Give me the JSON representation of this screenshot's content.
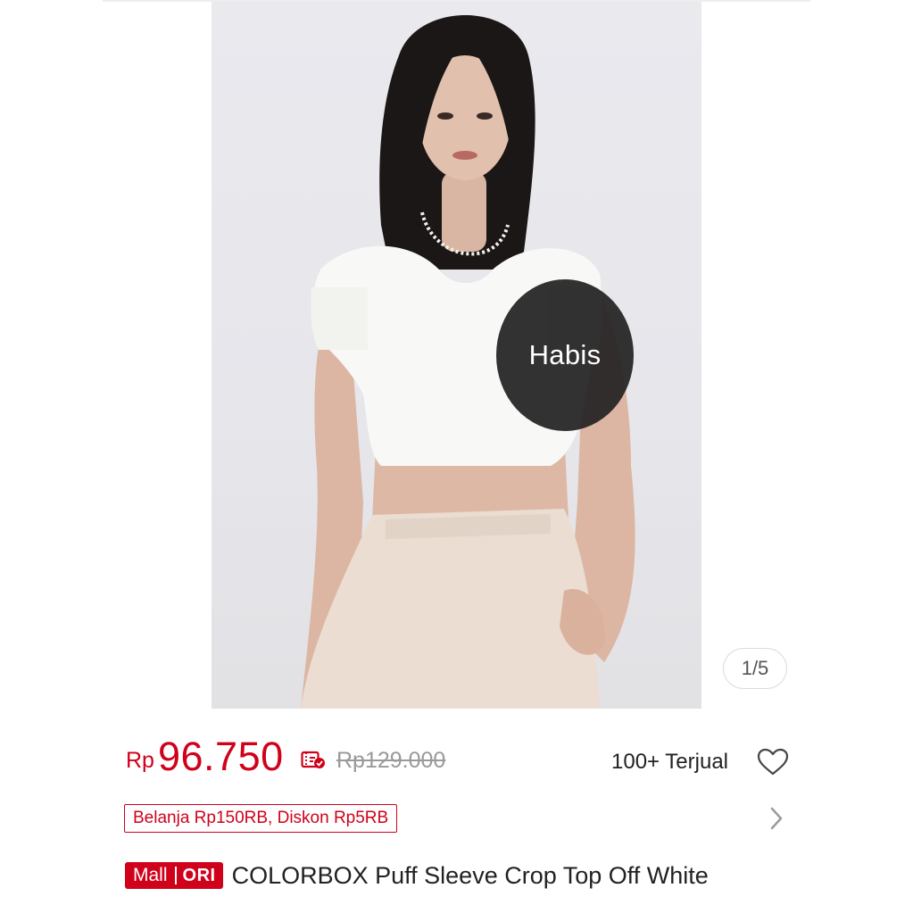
{
  "product": {
    "image_counter": "1/5",
    "stock_overlay": "Habis",
    "currency_prefix": "Rp",
    "price": "96.750",
    "original_price": "Rp129.000",
    "sold_count": "100+ Terjual",
    "promo_voucher": "Belanja Rp150RB, Diskon Rp5RB",
    "badge_mall": "Mall",
    "badge_ori": "ORI",
    "title": "COLORBOX Puff Sleeve Crop Top Off White"
  },
  "colors": {
    "accent": "#d0011b",
    "overlay": "#222222"
  },
  "icons": {
    "coupon": "coupon-check-icon",
    "favorite": "heart-outline-icon",
    "more": "chevron-right-icon"
  }
}
